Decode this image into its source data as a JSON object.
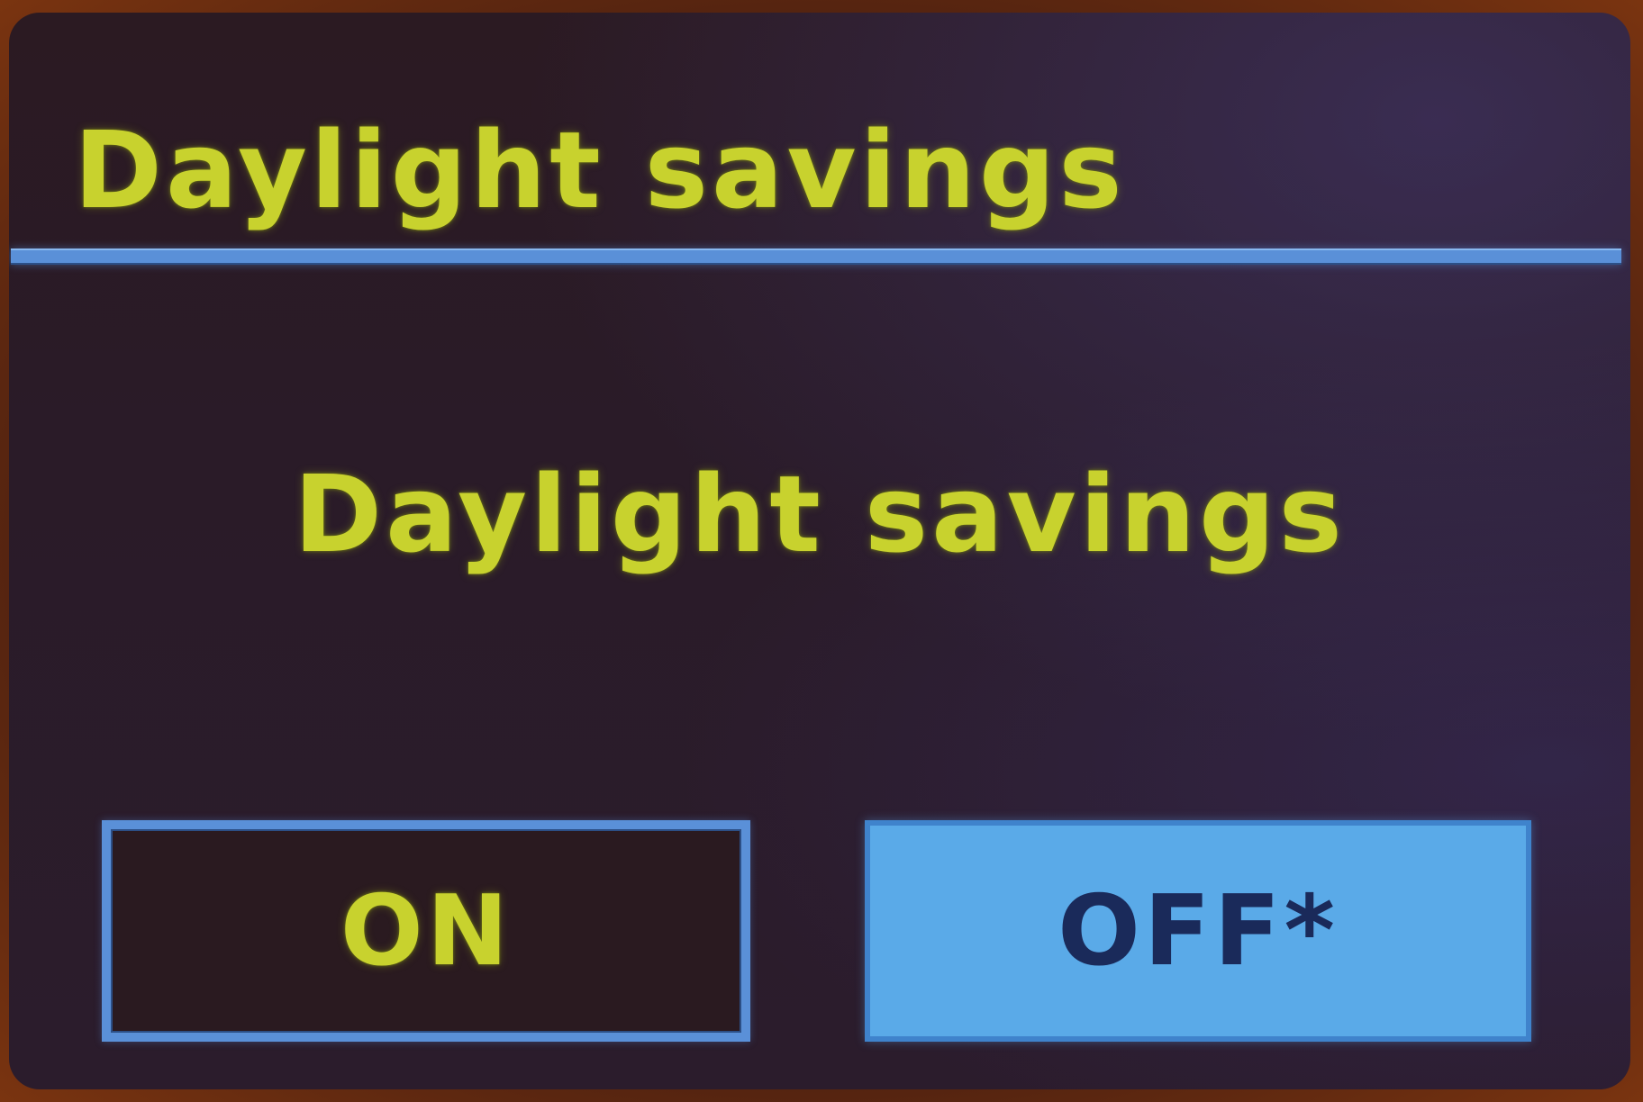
{
  "header": {
    "title": "Daylight savings"
  },
  "dialog": {
    "prompt": "Daylight savings",
    "options": [
      {
        "label": "ON",
        "selected": false
      },
      {
        "label": "OFF*",
        "selected": true
      }
    ]
  },
  "colors": {
    "text_yellow": "#c8d22e",
    "accent_blue": "#5a90d8",
    "selected_fill": "#5aaae8",
    "selected_text": "#1a2a5a",
    "background": "#2a1b26"
  }
}
